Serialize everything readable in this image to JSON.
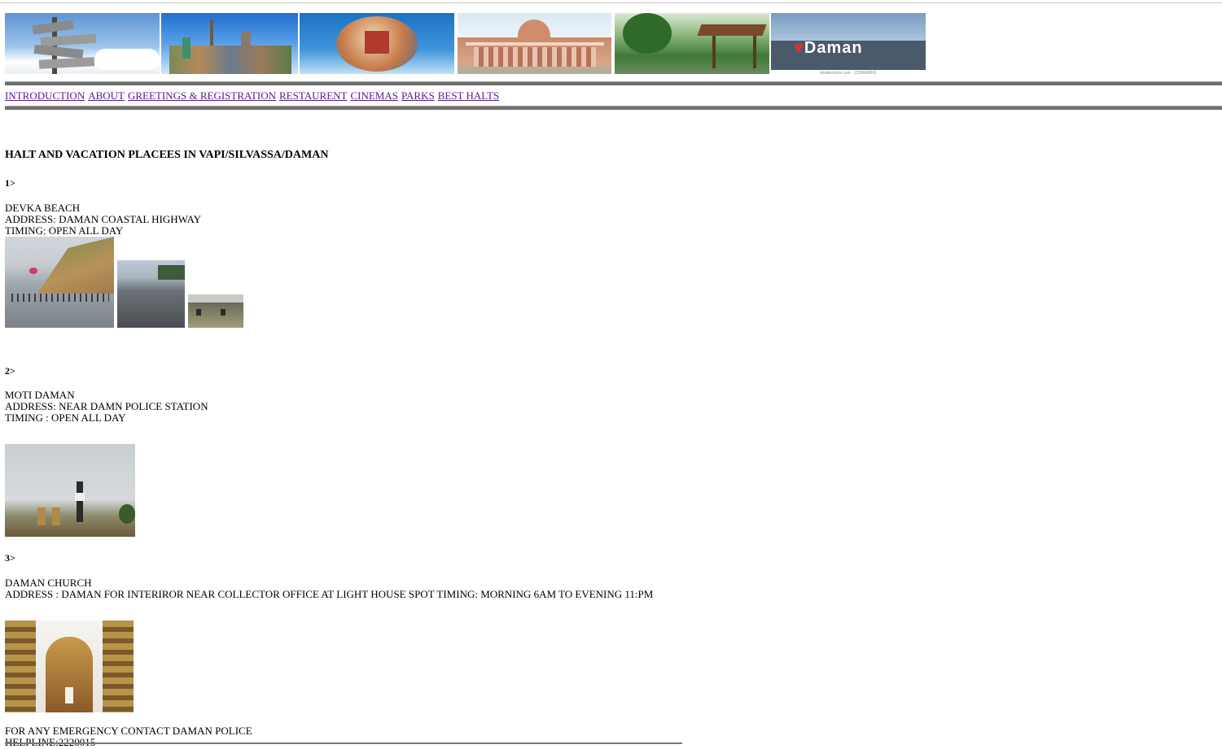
{
  "banner": [
    {
      "name": "help-support-signpost-image",
      "bg": "#6aa0d8"
    },
    {
      "name": "world-landmarks-image",
      "bg": "#4b8bd6"
    },
    {
      "name": "travel-globe-image",
      "bg": "#2f7cc4"
    },
    {
      "name": "palace-building-image",
      "bg": "#d9a48a"
    },
    {
      "name": "park-gazebo-image",
      "bg": "#4c8a4a"
    },
    {
      "name": "i-love-daman-image",
      "bg": "#7fa0c0",
      "caption": "shutterstock.com · 2228649661"
    }
  ],
  "nav": {
    "items": [
      "INTRODUCTION",
      "ABOUT",
      "GREETINGS & REGISTRATION",
      "RESTAURENT",
      "CINEMAS",
      "PARKS",
      "BEST HALTS"
    ]
  },
  "page": {
    "title": "HALT AND VACATION PLACEES IN VAPI/SILVASSA/DAMAN"
  },
  "places": [
    {
      "num": "1>",
      "name": "DEVKA BEACH",
      "address": "ADDRESS: DAMAN COASTAL HIGHWAY",
      "timing": "TIMING: OPEN ALL DAY"
    },
    {
      "num": "2>",
      "name": "MOTI DAMAN",
      "address": "ADDRESS: NEAR DAMN POLICE STATION",
      "timing": "TIMING : OPEN ALL DAY"
    },
    {
      "num": "3>",
      "name": "DAMAN CHURCH",
      "address": "ADDRESS : DAMAN FOR INTERIROR NEAR COLLECTOR OFFICE AT LIGHT HOUSE SPOT TIMING: MORNING 6AM TO EVENING 11:PM"
    }
  ],
  "footer": {
    "emergency": "FOR ANY EMERGENCY CONTACT DAMAN POLICE",
    "helpline": "HELPLINE:2220015"
  }
}
